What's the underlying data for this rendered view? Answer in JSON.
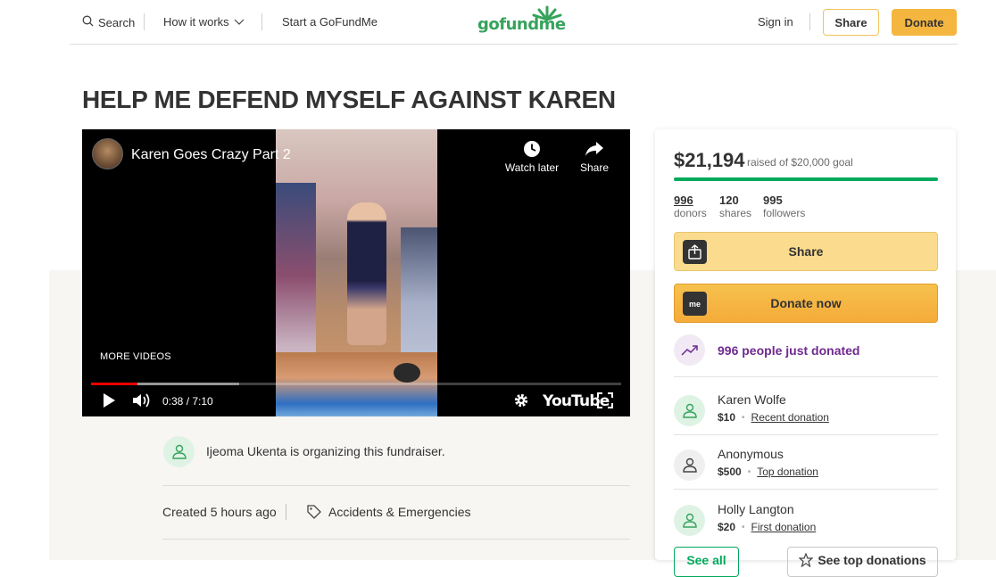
{
  "header": {
    "search_label": "Search",
    "how_it_works_label": "How it works",
    "start_label": "Start a GoFundMe",
    "logo_text": "gofundme",
    "sign_in_label": "Sign in",
    "share_label": "Share",
    "donate_label": "Donate"
  },
  "campaign": {
    "title": "HELP ME DEFEND MYSELF AGAINST KAREN"
  },
  "video": {
    "title": "Karen Goes Crazy Part 2",
    "watch_later_label": "Watch later",
    "share_label": "Share",
    "more_videos_label": "MORE VIDEOS",
    "time": "0:38 / 7:10",
    "played_fraction": 0.088,
    "buffered_fraction": 0.28,
    "youtube_label": "YouTube"
  },
  "organizer": {
    "text": "Ijeoma Ukenta is organizing this fundraiser.",
    "created": "Created 5 hours ago",
    "category": "Accidents & Emergencies"
  },
  "sidebar": {
    "amount": "$21,194",
    "goal_text": "raised of $20,000 goal",
    "goal_fraction": 1.0,
    "stats": [
      {
        "value": "996",
        "label": "donors"
      },
      {
        "value": "120",
        "label": "shares"
      },
      {
        "value": "995",
        "label": "followers"
      }
    ],
    "share_button": "Share",
    "donate_button": "Donate now",
    "donate_icon_text": "me",
    "trend_text": "996 people just donated",
    "donations": [
      {
        "name": "Karen Wolfe",
        "amount": "$10",
        "kind": "Recent donation"
      },
      {
        "name": "Anonymous",
        "amount": "$500",
        "kind": "Top donation"
      },
      {
        "name": "Holly Langton",
        "amount": "$20",
        "kind": "First donation"
      }
    ],
    "see_all_label": "See all",
    "see_top_label": "See top donations"
  },
  "colors": {
    "brand_green": "#02a95c",
    "donate_orange": "#f5ab3a",
    "trend_purple": "#6f2a8f"
  }
}
